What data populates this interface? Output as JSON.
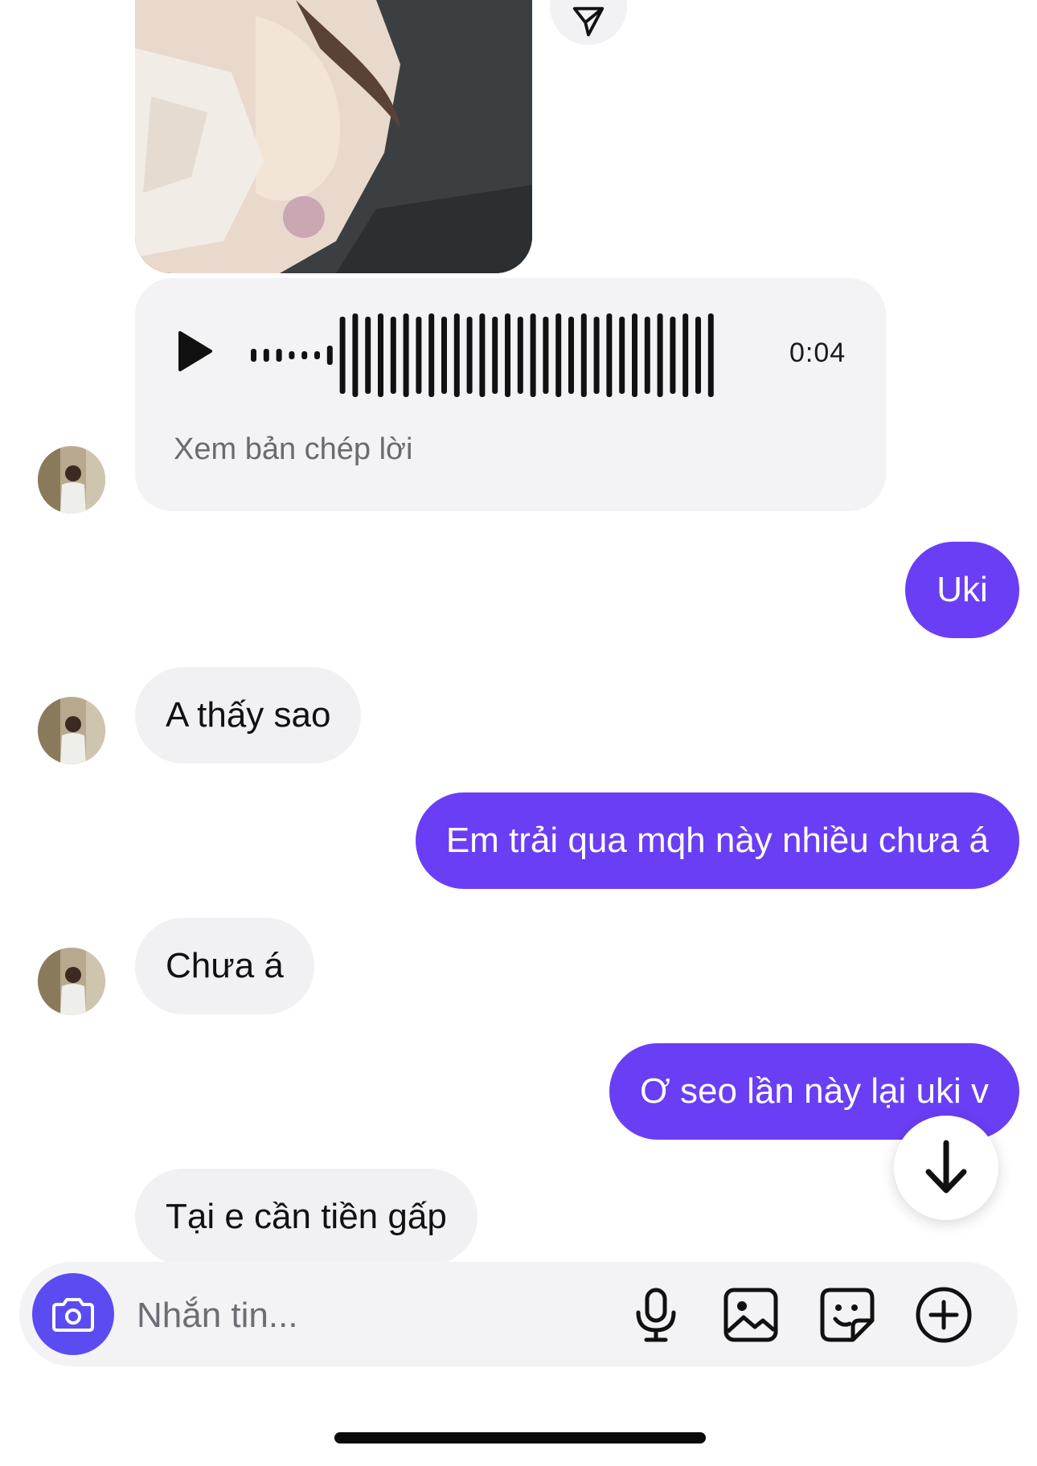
{
  "photo": {
    "name": "shared-photo"
  },
  "voice_message": {
    "duration": "0:04",
    "transcript_link": "Xem bản chép lời",
    "played_fraction": 0.12
  },
  "messages": [
    {
      "side": "out",
      "text": "Uki"
    },
    {
      "side": "in",
      "text": "A thấy sao"
    },
    {
      "side": "out",
      "text": "Em trải qua mqh này nhiều chưa á"
    },
    {
      "side": "in",
      "text": "Chưa á"
    },
    {
      "side": "out",
      "text": "Ơ seo lần này lại uki v"
    },
    {
      "side": "in",
      "text": "Tại e cần tiền gấp"
    }
  ],
  "composer": {
    "placeholder": "Nhắn tin...",
    "icons": [
      "camera-icon",
      "microphone-icon",
      "gallery-icon",
      "sticker-icon",
      "plus-icon"
    ]
  },
  "colors": {
    "outgoing_bubble": "#6a3ef5",
    "incoming_bubble": "#f1f1f4",
    "camera_button": "#5b4cf2"
  }
}
